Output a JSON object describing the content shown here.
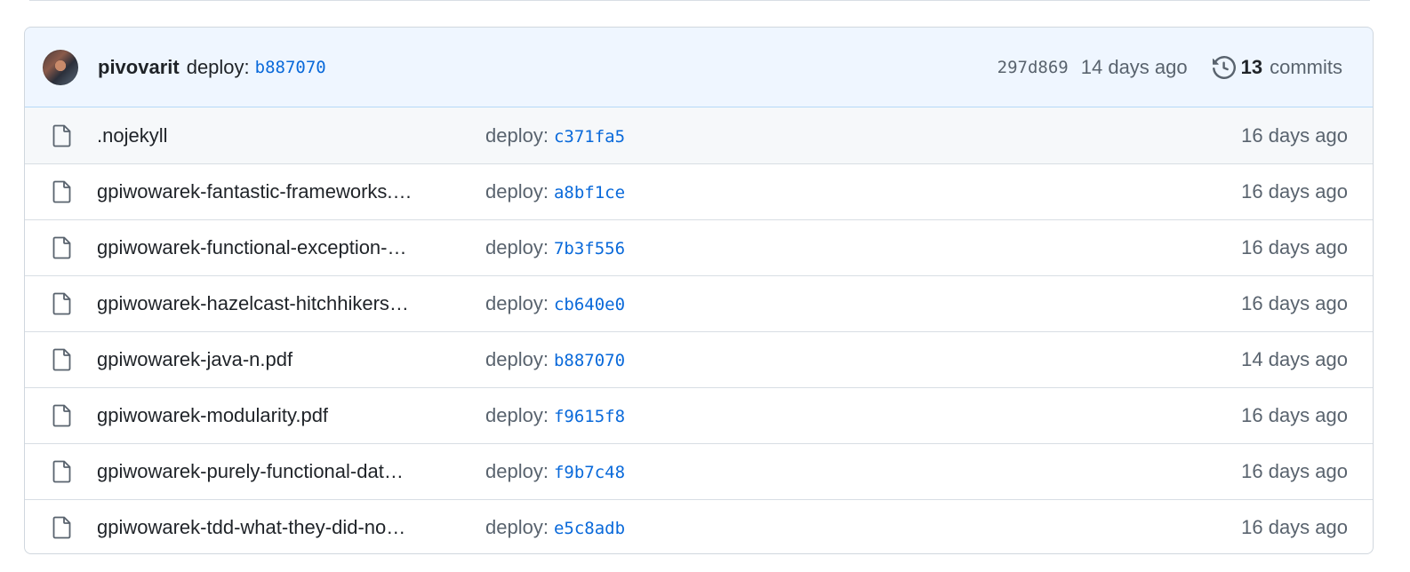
{
  "latest_commit": {
    "author": "pivovarit",
    "message": "deploy:",
    "message_sha": "b887070",
    "sha": "297d869",
    "age": "14 days ago",
    "commits_count": "13",
    "commits_label": "commits"
  },
  "files": [
    {
      "name": ".nojekyll",
      "commit_label": "deploy:",
      "commit_sha": "c371fa5",
      "age": "16 days ago"
    },
    {
      "name": "gpiwowarek-fantastic-frameworks.…",
      "commit_label": "deploy:",
      "commit_sha": "a8bf1ce",
      "age": "16 days ago"
    },
    {
      "name": "gpiwowarek-functional-exception-…",
      "commit_label": "deploy:",
      "commit_sha": "7b3f556",
      "age": "16 days ago"
    },
    {
      "name": "gpiwowarek-hazelcast-hitchhikers…",
      "commit_label": "deploy:",
      "commit_sha": "cb640e0",
      "age": "16 days ago"
    },
    {
      "name": "gpiwowarek-java-n.pdf",
      "commit_label": "deploy:",
      "commit_sha": "b887070",
      "age": "14 days ago"
    },
    {
      "name": "gpiwowarek-modularity.pdf",
      "commit_label": "deploy:",
      "commit_sha": "f9615f8",
      "age": "16 days ago"
    },
    {
      "name": "gpiwowarek-purely-functional-dat…",
      "commit_label": "deploy:",
      "commit_sha": "f9b7c48",
      "age": "16 days ago"
    },
    {
      "name": "gpiwowarek-tdd-what-they-did-no…",
      "commit_label": "deploy:",
      "commit_sha": "e5c8adb",
      "age": "16 days ago"
    }
  ],
  "icons": {
    "file": "file-icon",
    "history": "history-icon"
  },
  "colors": {
    "link": "#0969da",
    "muted": "#59636e",
    "header_bg": "#eff6ff"
  }
}
